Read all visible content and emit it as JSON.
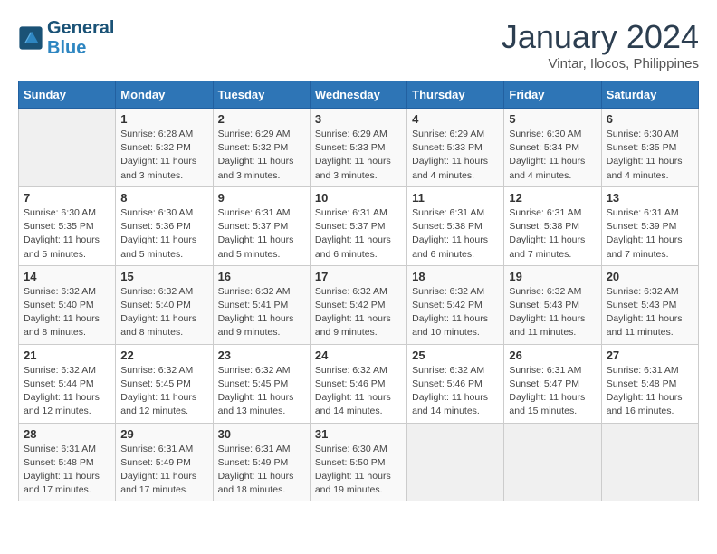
{
  "header": {
    "logo_line1": "General",
    "logo_line2": "Blue",
    "month": "January 2024",
    "location": "Vintar, Ilocos, Philippines"
  },
  "days_of_week": [
    "Sunday",
    "Monday",
    "Tuesday",
    "Wednesday",
    "Thursday",
    "Friday",
    "Saturday"
  ],
  "weeks": [
    [
      {
        "day": "",
        "sunrise": "",
        "sunset": "",
        "daylight": ""
      },
      {
        "day": "1",
        "sunrise": "Sunrise: 6:28 AM",
        "sunset": "Sunset: 5:32 PM",
        "daylight": "Daylight: 11 hours and 3 minutes."
      },
      {
        "day": "2",
        "sunrise": "Sunrise: 6:29 AM",
        "sunset": "Sunset: 5:32 PM",
        "daylight": "Daylight: 11 hours and 3 minutes."
      },
      {
        "day": "3",
        "sunrise": "Sunrise: 6:29 AM",
        "sunset": "Sunset: 5:33 PM",
        "daylight": "Daylight: 11 hours and 3 minutes."
      },
      {
        "day": "4",
        "sunrise": "Sunrise: 6:29 AM",
        "sunset": "Sunset: 5:33 PM",
        "daylight": "Daylight: 11 hours and 4 minutes."
      },
      {
        "day": "5",
        "sunrise": "Sunrise: 6:30 AM",
        "sunset": "Sunset: 5:34 PM",
        "daylight": "Daylight: 11 hours and 4 minutes."
      },
      {
        "day": "6",
        "sunrise": "Sunrise: 6:30 AM",
        "sunset": "Sunset: 5:35 PM",
        "daylight": "Daylight: 11 hours and 4 minutes."
      }
    ],
    [
      {
        "day": "7",
        "sunrise": "Sunrise: 6:30 AM",
        "sunset": "Sunset: 5:35 PM",
        "daylight": "Daylight: 11 hours and 5 minutes."
      },
      {
        "day": "8",
        "sunrise": "Sunrise: 6:30 AM",
        "sunset": "Sunset: 5:36 PM",
        "daylight": "Daylight: 11 hours and 5 minutes."
      },
      {
        "day": "9",
        "sunrise": "Sunrise: 6:31 AM",
        "sunset": "Sunset: 5:37 PM",
        "daylight": "Daylight: 11 hours and 5 minutes."
      },
      {
        "day": "10",
        "sunrise": "Sunrise: 6:31 AM",
        "sunset": "Sunset: 5:37 PM",
        "daylight": "Daylight: 11 hours and 6 minutes."
      },
      {
        "day": "11",
        "sunrise": "Sunrise: 6:31 AM",
        "sunset": "Sunset: 5:38 PM",
        "daylight": "Daylight: 11 hours and 6 minutes."
      },
      {
        "day": "12",
        "sunrise": "Sunrise: 6:31 AM",
        "sunset": "Sunset: 5:38 PM",
        "daylight": "Daylight: 11 hours and 7 minutes."
      },
      {
        "day": "13",
        "sunrise": "Sunrise: 6:31 AM",
        "sunset": "Sunset: 5:39 PM",
        "daylight": "Daylight: 11 hours and 7 minutes."
      }
    ],
    [
      {
        "day": "14",
        "sunrise": "Sunrise: 6:32 AM",
        "sunset": "Sunset: 5:40 PM",
        "daylight": "Daylight: 11 hours and 8 minutes."
      },
      {
        "day": "15",
        "sunrise": "Sunrise: 6:32 AM",
        "sunset": "Sunset: 5:40 PM",
        "daylight": "Daylight: 11 hours and 8 minutes."
      },
      {
        "day": "16",
        "sunrise": "Sunrise: 6:32 AM",
        "sunset": "Sunset: 5:41 PM",
        "daylight": "Daylight: 11 hours and 9 minutes."
      },
      {
        "day": "17",
        "sunrise": "Sunrise: 6:32 AM",
        "sunset": "Sunset: 5:42 PM",
        "daylight": "Daylight: 11 hours and 9 minutes."
      },
      {
        "day": "18",
        "sunrise": "Sunrise: 6:32 AM",
        "sunset": "Sunset: 5:42 PM",
        "daylight": "Daylight: 11 hours and 10 minutes."
      },
      {
        "day": "19",
        "sunrise": "Sunrise: 6:32 AM",
        "sunset": "Sunset: 5:43 PM",
        "daylight": "Daylight: 11 hours and 11 minutes."
      },
      {
        "day": "20",
        "sunrise": "Sunrise: 6:32 AM",
        "sunset": "Sunset: 5:43 PM",
        "daylight": "Daylight: 11 hours and 11 minutes."
      }
    ],
    [
      {
        "day": "21",
        "sunrise": "Sunrise: 6:32 AM",
        "sunset": "Sunset: 5:44 PM",
        "daylight": "Daylight: 11 hours and 12 minutes."
      },
      {
        "day": "22",
        "sunrise": "Sunrise: 6:32 AM",
        "sunset": "Sunset: 5:45 PM",
        "daylight": "Daylight: 11 hours and 12 minutes."
      },
      {
        "day": "23",
        "sunrise": "Sunrise: 6:32 AM",
        "sunset": "Sunset: 5:45 PM",
        "daylight": "Daylight: 11 hours and 13 minutes."
      },
      {
        "day": "24",
        "sunrise": "Sunrise: 6:32 AM",
        "sunset": "Sunset: 5:46 PM",
        "daylight": "Daylight: 11 hours and 14 minutes."
      },
      {
        "day": "25",
        "sunrise": "Sunrise: 6:32 AM",
        "sunset": "Sunset: 5:46 PM",
        "daylight": "Daylight: 11 hours and 14 minutes."
      },
      {
        "day": "26",
        "sunrise": "Sunrise: 6:31 AM",
        "sunset": "Sunset: 5:47 PM",
        "daylight": "Daylight: 11 hours and 15 minutes."
      },
      {
        "day": "27",
        "sunrise": "Sunrise: 6:31 AM",
        "sunset": "Sunset: 5:48 PM",
        "daylight": "Daylight: 11 hours and 16 minutes."
      }
    ],
    [
      {
        "day": "28",
        "sunrise": "Sunrise: 6:31 AM",
        "sunset": "Sunset: 5:48 PM",
        "daylight": "Daylight: 11 hours and 17 minutes."
      },
      {
        "day": "29",
        "sunrise": "Sunrise: 6:31 AM",
        "sunset": "Sunset: 5:49 PM",
        "daylight": "Daylight: 11 hours and 17 minutes."
      },
      {
        "day": "30",
        "sunrise": "Sunrise: 6:31 AM",
        "sunset": "Sunset: 5:49 PM",
        "daylight": "Daylight: 11 hours and 18 minutes."
      },
      {
        "day": "31",
        "sunrise": "Sunrise: 6:30 AM",
        "sunset": "Sunset: 5:50 PM",
        "daylight": "Daylight: 11 hours and 19 minutes."
      },
      {
        "day": "",
        "sunrise": "",
        "sunset": "",
        "daylight": ""
      },
      {
        "day": "",
        "sunrise": "",
        "sunset": "",
        "daylight": ""
      },
      {
        "day": "",
        "sunrise": "",
        "sunset": "",
        "daylight": ""
      }
    ]
  ]
}
